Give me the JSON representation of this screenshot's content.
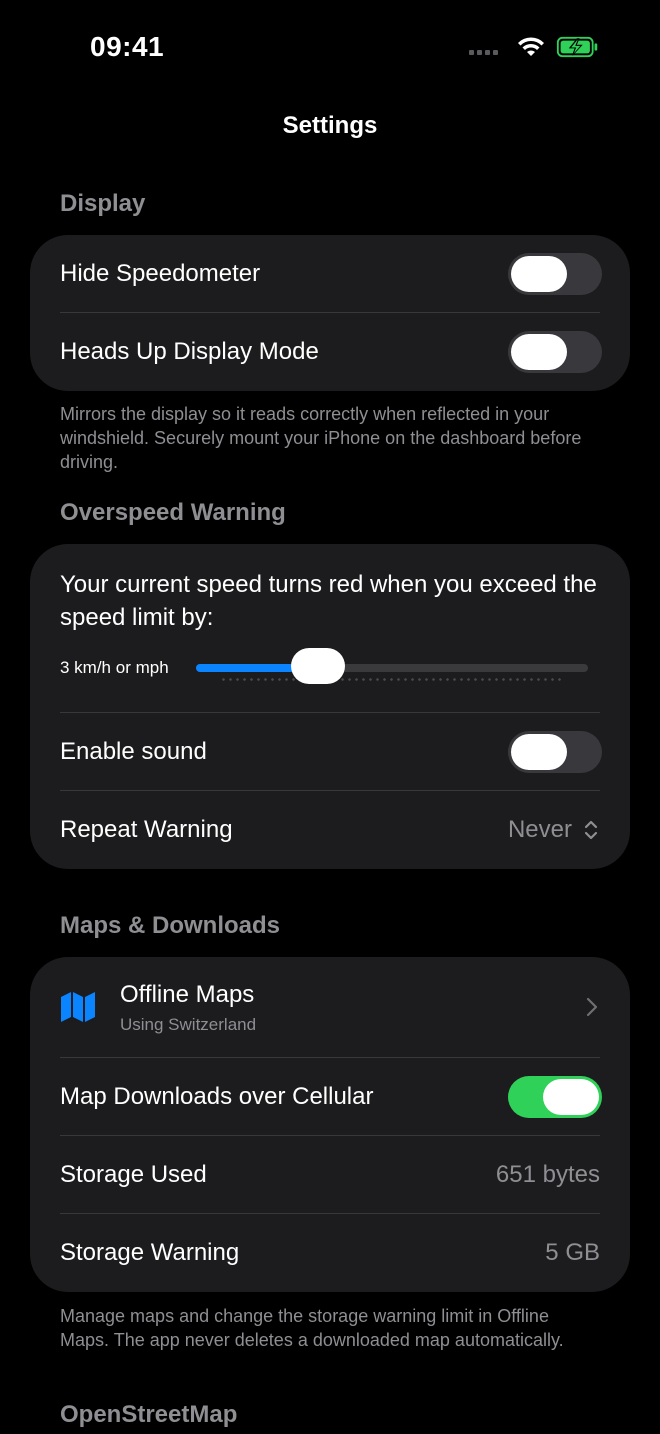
{
  "status_bar": {
    "time": "09:41",
    "signal_icon": "cellular-dots-icon",
    "wifi_icon": "wifi-icon",
    "battery_icon": "battery-charging-icon",
    "battery_color": "#30d158"
  },
  "nav": {
    "title": "Settings"
  },
  "display": {
    "header": "Display",
    "hide_speedometer": {
      "label": "Hide Speedometer",
      "on": false
    },
    "hud_mode": {
      "label": "Heads Up Display Mode",
      "on": false
    },
    "footer": "Mirrors the display so it reads correctly when reflected in your windshield. Securely mount your iPhone on the dashboard before driving."
  },
  "overspeed": {
    "header": "Overspeed Warning",
    "description": "Your current speed turns red when you exceed the speed limit by:",
    "slider_label": "3 km/h or mph",
    "slider_fraction": 0.31,
    "enable_sound": {
      "label": "Enable sound",
      "on": false
    },
    "repeat_warning": {
      "label": "Repeat Warning",
      "value": "Never"
    }
  },
  "maps": {
    "header": "Maps & Downloads",
    "offline_maps": {
      "label": "Offline Maps",
      "subtitle": "Using Switzerland",
      "icon": "map-icon"
    },
    "cellular": {
      "label": "Map Downloads over Cellular",
      "on": true
    },
    "storage_used": {
      "label": "Storage Used",
      "value": "651 bytes"
    },
    "storage_warning": {
      "label": "Storage Warning",
      "value": "5 GB"
    },
    "footer": "Manage maps and change the storage warning limit in Offline Maps. The app never deletes a downloaded map automatically."
  },
  "osm": {
    "header": "OpenStreetMap"
  },
  "colors": {
    "accent": "#0a84ff",
    "toggle_on": "#30d158",
    "group_bg": "#1c1c1e",
    "secondary_text": "#8e8e93"
  }
}
